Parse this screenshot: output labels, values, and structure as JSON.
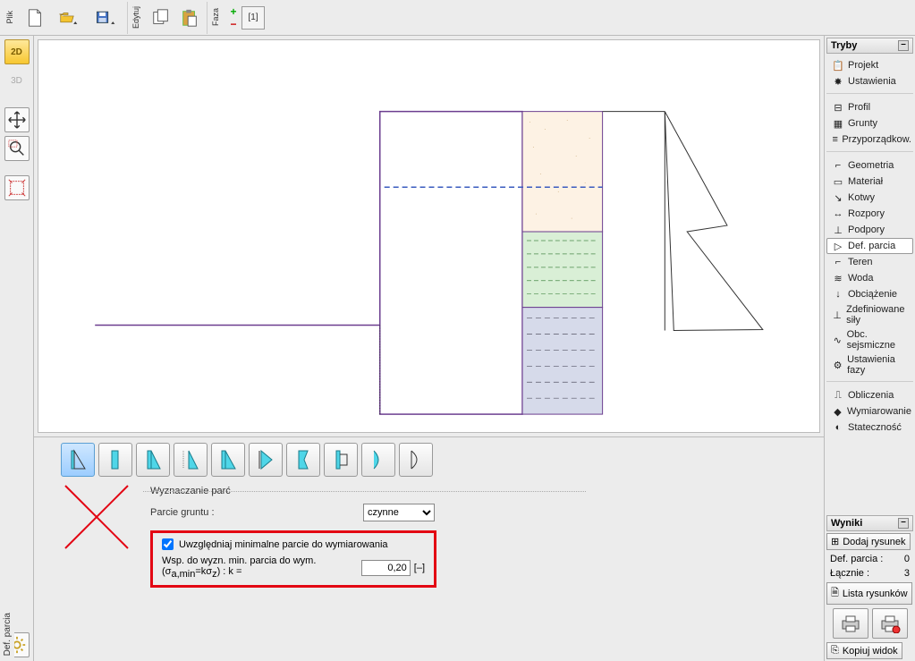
{
  "toolbar": {
    "file_label": "Plik",
    "edit_label": "Edytuj",
    "phase_label": "Faza",
    "phase_current": "[1]"
  },
  "left_tools": {
    "btn_2d": "2D",
    "btn_3d": "3D"
  },
  "right_panel": {
    "modes_title": "Tryby",
    "results_title": "Wyniki",
    "groups": [
      {
        "id": "g1",
        "items": [
          {
            "key": "projekt",
            "label": "Projekt",
            "icon": "📋"
          },
          {
            "key": "ustawienia",
            "label": "Ustawienia",
            "icon": "✸"
          }
        ]
      },
      {
        "id": "g2",
        "items": [
          {
            "key": "profil",
            "label": "Profil",
            "icon": "⊟"
          },
          {
            "key": "grunty",
            "label": "Grunty",
            "icon": "▦"
          },
          {
            "key": "przyporz",
            "label": "Przyporządkow.",
            "icon": "≡"
          }
        ]
      },
      {
        "id": "g3",
        "items": [
          {
            "key": "geometria",
            "label": "Geometria",
            "icon": "⌐"
          },
          {
            "key": "material",
            "label": "Materiał",
            "icon": "▭"
          },
          {
            "key": "kotwy",
            "label": "Kotwy",
            "icon": "↘"
          },
          {
            "key": "rozpory",
            "label": "Rozpory",
            "icon": "↔"
          },
          {
            "key": "podpory",
            "label": "Podpory",
            "icon": "⊥"
          },
          {
            "key": "defparcia",
            "label": "Def. parcia",
            "icon": "▷",
            "selected": true
          },
          {
            "key": "teren",
            "label": "Teren",
            "icon": "⌐"
          },
          {
            "key": "woda",
            "label": "Woda",
            "icon": "≋"
          },
          {
            "key": "obciazenie",
            "label": "Obciążenie",
            "icon": "↓"
          },
          {
            "key": "zdefsily",
            "label": "Zdefiniowane siły",
            "icon": "⊥"
          },
          {
            "key": "obcsejsm",
            "label": "Obc. sejsmiczne",
            "icon": "∿"
          },
          {
            "key": "ustfazy",
            "label": "Ustawienia fazy",
            "icon": "⚙"
          }
        ]
      },
      {
        "id": "g4",
        "items": [
          {
            "key": "obliczenia",
            "label": "Obliczenia",
            "icon": "⎍"
          },
          {
            "key": "wymiar",
            "label": "Wymiarowanie",
            "icon": "◆"
          },
          {
            "key": "statecznosc",
            "label": "Stateczność",
            "icon": "◐"
          }
        ]
      }
    ],
    "dodaj_rysunek": "Dodaj rysunek",
    "def_parcia_label": "Def. parcia :",
    "def_parcia_val": "0",
    "lacznie_label": "Łącznie :",
    "lacznie_val": "3",
    "lista_rysunkow": "Lista rysunków",
    "kopiuj_widok": "Kopiuj widok"
  },
  "bottom": {
    "fieldset": "Wyznaczanie parć",
    "parcie_gruntu_label": "Parcie gruntu :",
    "parcie_gruntu_value": "czynne",
    "checkbox_label": "Uwzględniaj minimalne parcie do wymiarowania",
    "coef_label_prefix": "Wsp. do wyzn. min. parcia do wym. (σ",
    "coef_sub1": "a,min",
    "coef_mid": "=kσ",
    "coef_sub2": "z",
    "coef_suffix": ") :   k =",
    "coef_value": "0,20",
    "coef_unit": "[–]"
  },
  "status": {
    "mode_name": "Def. parcia"
  }
}
